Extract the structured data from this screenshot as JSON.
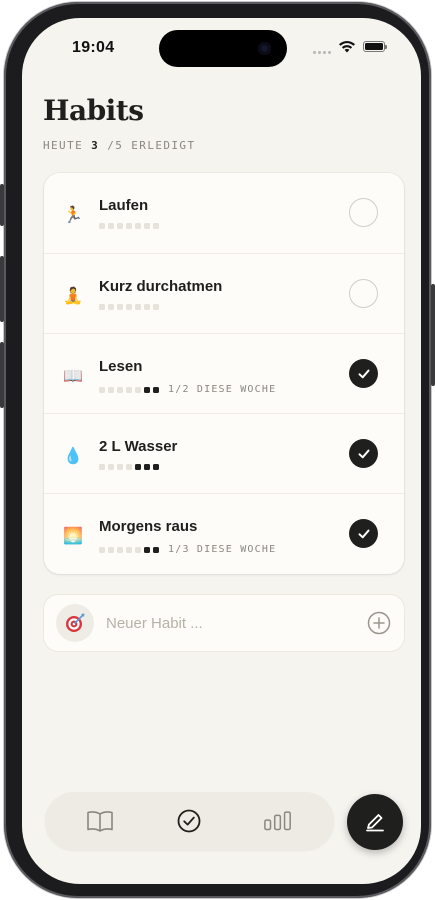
{
  "status_bar": {
    "time": "19:04"
  },
  "header": {
    "title": "Habits",
    "subtitle_prefix": "HEUTE",
    "done_count": "3",
    "subtitle_suffix": "/5 ERLEDIGT"
  },
  "habits": [
    {
      "emoji": "🏃",
      "icon": "running-icon",
      "name": "Laufen",
      "week_total": 7,
      "week_done": 0,
      "note": "",
      "done": false
    },
    {
      "emoji": "🧘",
      "icon": "meditation-icon",
      "name": "Kurz durchatmen",
      "week_total": 7,
      "week_done": 0,
      "note": "",
      "done": false
    },
    {
      "emoji": "📖",
      "icon": "book-icon",
      "name": "Lesen",
      "week_total": 7,
      "week_done": 2,
      "note": "1/2 DIESE WOCHE",
      "done": true
    },
    {
      "emoji": "💧",
      "icon": "water-drop-icon",
      "name": "2 L Wasser",
      "week_total": 7,
      "week_done": 3,
      "note": "",
      "done": true
    },
    {
      "emoji": "🌅",
      "icon": "sunrise-icon",
      "name": "Morgens raus",
      "week_total": 7,
      "week_done": 2,
      "note": "1/3 DIESE WOCHE",
      "done": true
    }
  ],
  "new_habit": {
    "placeholder": "Neuer Habit ...",
    "avatar_icon": "target-icon",
    "add_icon": "plus-circle-icon"
  },
  "tabbar": {
    "tabs": [
      "journal-tab",
      "habits-tab",
      "stats-tab"
    ],
    "active": "habits-tab"
  },
  "fab": {
    "icon": "pen-icon"
  },
  "colors": {
    "background": "#f6f4ef",
    "card": "#fdfcf9",
    "ink": "#1f1f1d",
    "muted": "#8a877f"
  }
}
